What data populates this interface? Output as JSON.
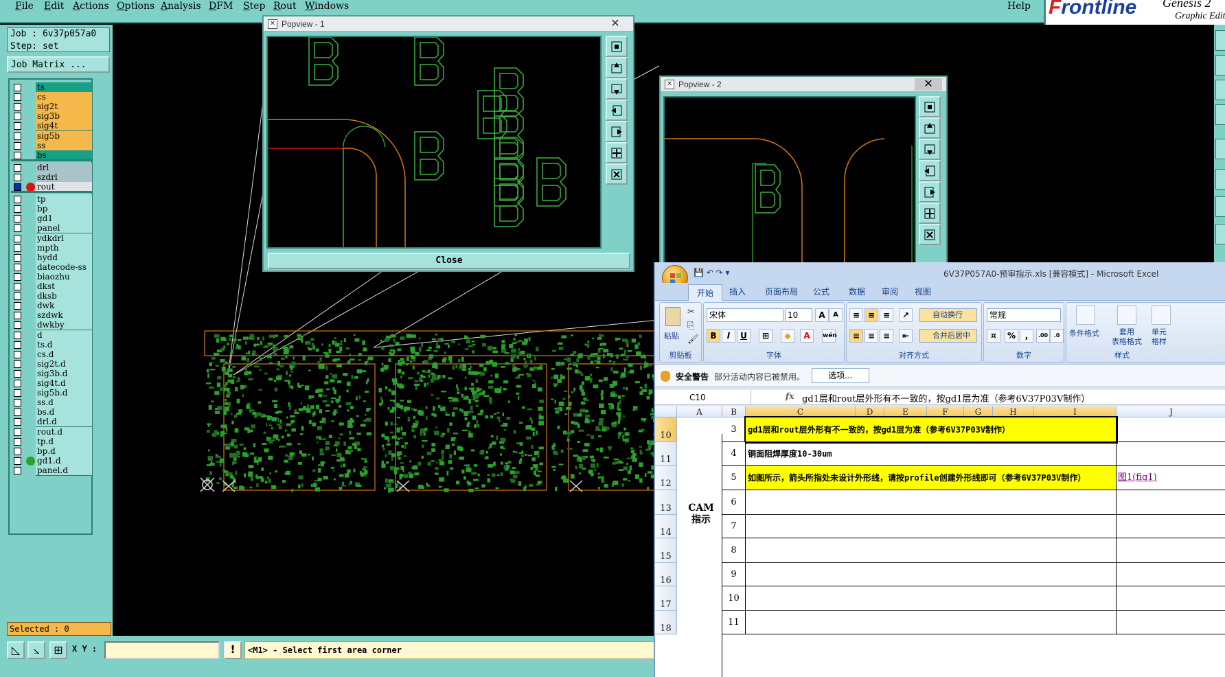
{
  "menu": {
    "items": [
      "File",
      "Edit",
      "Actions",
      "Options",
      "Analysis",
      "DFM",
      "Step",
      "Rout",
      "Windows"
    ],
    "help": "Help"
  },
  "logo": {
    "brand": "Frontline",
    "product": "Genesis 2",
    "subtitle": "Graphic Edit"
  },
  "job": {
    "label": "Job : 6v37p057a0",
    "step": "Step: set",
    "matrix_button": "Job Matrix ..."
  },
  "layers": [
    {
      "name": "ts",
      "color": "#16a085",
      "checked": false
    },
    {
      "name": "cs",
      "color": "#f5b84a",
      "checked": false
    },
    {
      "name": "sig2t",
      "color": "#f5b84a",
      "checked": false
    },
    {
      "name": "sig3b",
      "color": "#f5b84a",
      "checked": false
    },
    {
      "name": "sig4t",
      "color": "#f5b84a",
      "checked": false
    },
    {
      "name": "sig5b",
      "color": "#f5b84a",
      "checked": false
    },
    {
      "name": "ss",
      "color": "#f5b84a",
      "checked": false
    },
    {
      "name": "bs",
      "color": "#16a085",
      "checked": false
    },
    {
      "name": "drl",
      "color": "#a8c4c8",
      "checked": false
    },
    {
      "name": "szdrl",
      "color": "#a8c4c8",
      "checked": false
    },
    {
      "name": "rout",
      "color": "#e0e4e8",
      "checked": true,
      "dot": "#e01010"
    },
    {
      "name": "tp",
      "color": "#a6e3dc",
      "checked": false
    },
    {
      "name": "bp",
      "color": "#a6e3dc",
      "checked": false
    },
    {
      "name": "gd1",
      "color": "#a6e3dc",
      "checked": false
    },
    {
      "name": "panel",
      "color": "#a6e3dc",
      "checked": false
    },
    {
      "name": "ydkdrl",
      "color": "#a6e3dc",
      "checked": false
    },
    {
      "name": "mpth",
      "color": "#a6e3dc",
      "checked": false
    },
    {
      "name": "hydd",
      "color": "#a6e3dc",
      "checked": false
    },
    {
      "name": "datecode-ss",
      "color": "#a6e3dc",
      "checked": false
    },
    {
      "name": "biaozhu",
      "color": "#a6e3dc",
      "checked": false
    },
    {
      "name": "dkst",
      "color": "#a6e3dc",
      "checked": false
    },
    {
      "name": "dksb",
      "color": "#a6e3dc",
      "checked": false
    },
    {
      "name": "dwk",
      "color": "#a6e3dc",
      "checked": false
    },
    {
      "name": "szdwk",
      "color": "#a6e3dc",
      "checked": false
    },
    {
      "name": "dwkby",
      "color": "#a6e3dc",
      "checked": false
    },
    {
      "name": "d",
      "color": "#a6e3dc",
      "checked": false
    },
    {
      "name": "ts.d",
      "color": "#a6e3dc",
      "checked": false
    },
    {
      "name": "cs.d",
      "color": "#a6e3dc",
      "checked": false
    },
    {
      "name": "sig2t.d",
      "color": "#a6e3dc",
      "checked": false
    },
    {
      "name": "sig3b.d",
      "color": "#a6e3dc",
      "checked": false
    },
    {
      "name": "sig4t.d",
      "color": "#a6e3dc",
      "checked": false
    },
    {
      "name": "sig5b.d",
      "color": "#a6e3dc",
      "checked": false
    },
    {
      "name": "ss.d",
      "color": "#a6e3dc",
      "checked": false
    },
    {
      "name": "bs.d",
      "color": "#a6e3dc",
      "checked": false
    },
    {
      "name": "drl.d",
      "color": "#a6e3dc",
      "checked": false
    },
    {
      "name": "rout.d",
      "color": "#a6e3dc",
      "checked": false
    },
    {
      "name": "tp.d",
      "color": "#a6e3dc",
      "checked": false
    },
    {
      "name": "bp.d",
      "color": "#a6e3dc",
      "checked": false
    },
    {
      "name": "gd1.d",
      "color": "#a6e3dc",
      "checked": false,
      "dot": "#2ca02c"
    },
    {
      "name": "panel.d",
      "color": "#a6e3dc",
      "checked": false
    }
  ],
  "selected": "Selected : 0",
  "status": {
    "xy_label": "X Y :",
    "xy_value": "",
    "info": "!",
    "prompt": "<M1> - Select first area corner"
  },
  "popview1": {
    "title": "Popview - 1",
    "close": "Close"
  },
  "popview2": {
    "title": "Popview - 2"
  },
  "excel": {
    "title": "6V37P057A0-预审指示.xls [兼容模式] - Microsoft Excel",
    "tabs": [
      "开始",
      "插入",
      "页面布局",
      "公式",
      "数据",
      "审阅",
      "视图"
    ],
    "font_name": "宋体",
    "font_size": "10",
    "number_format": "常规",
    "wrap_text": "自动换行",
    "merge_center": "合并后居中",
    "paste": "粘贴",
    "cond_format": "条件格式",
    "table_format": "套用\n表格格式",
    "cell_style": "单元\n格样",
    "groups": [
      "剪贴板",
      "字体",
      "对齐方式",
      "数字",
      "样式"
    ],
    "security_title": "安全警告",
    "security_msg": "部分活动内容已被禁用。",
    "security_btn": "选项...",
    "namebox": "C10",
    "fx": "fx",
    "formula": "gd1层和rout层外形有不一致的，按gd1层为准（参考6V37P03V制作）",
    "columns": [
      "A",
      "B",
      "C",
      "D",
      "E",
      "F",
      "G",
      "H",
      "I",
      "J"
    ],
    "category": "CAM\n指示",
    "rows": [
      {
        "row": "10",
        "num": "3",
        "text": "gd1层和rout层外形有不一致的，按gd1层为准（参考6V37P03V制作）",
        "highlight": true,
        "j": ""
      },
      {
        "row": "11",
        "num": "4",
        "text": "铜面阻焊厚度10-30um",
        "highlight": false,
        "j": ""
      },
      {
        "row": "12",
        "num": "5",
        "text": "如图所示，箭头所指处未设计外形线，请按profile创建外形线即可（参考6V37P03V制作）",
        "highlight": true,
        "j": "图1(fig1)"
      },
      {
        "row": "13",
        "num": "6",
        "text": "",
        "highlight": false,
        "j": ""
      },
      {
        "row": "14",
        "num": "7",
        "text": "",
        "highlight": false,
        "j": ""
      },
      {
        "row": "15",
        "num": "8",
        "text": "",
        "highlight": false,
        "j": ""
      },
      {
        "row": "16",
        "num": "9",
        "text": "",
        "highlight": false,
        "j": ""
      },
      {
        "row": "17",
        "num": "10",
        "text": "",
        "highlight": false,
        "j": ""
      },
      {
        "row": "18",
        "num": "11",
        "text": "",
        "highlight": false,
        "j": ""
      }
    ]
  },
  "colors": {
    "teal": "#7fd1c7",
    "orange": "#f5b84a",
    "pcb_green": "#2ca02c",
    "rout_orange": "#d47a10",
    "highlight_yellow": "#ffff00"
  }
}
